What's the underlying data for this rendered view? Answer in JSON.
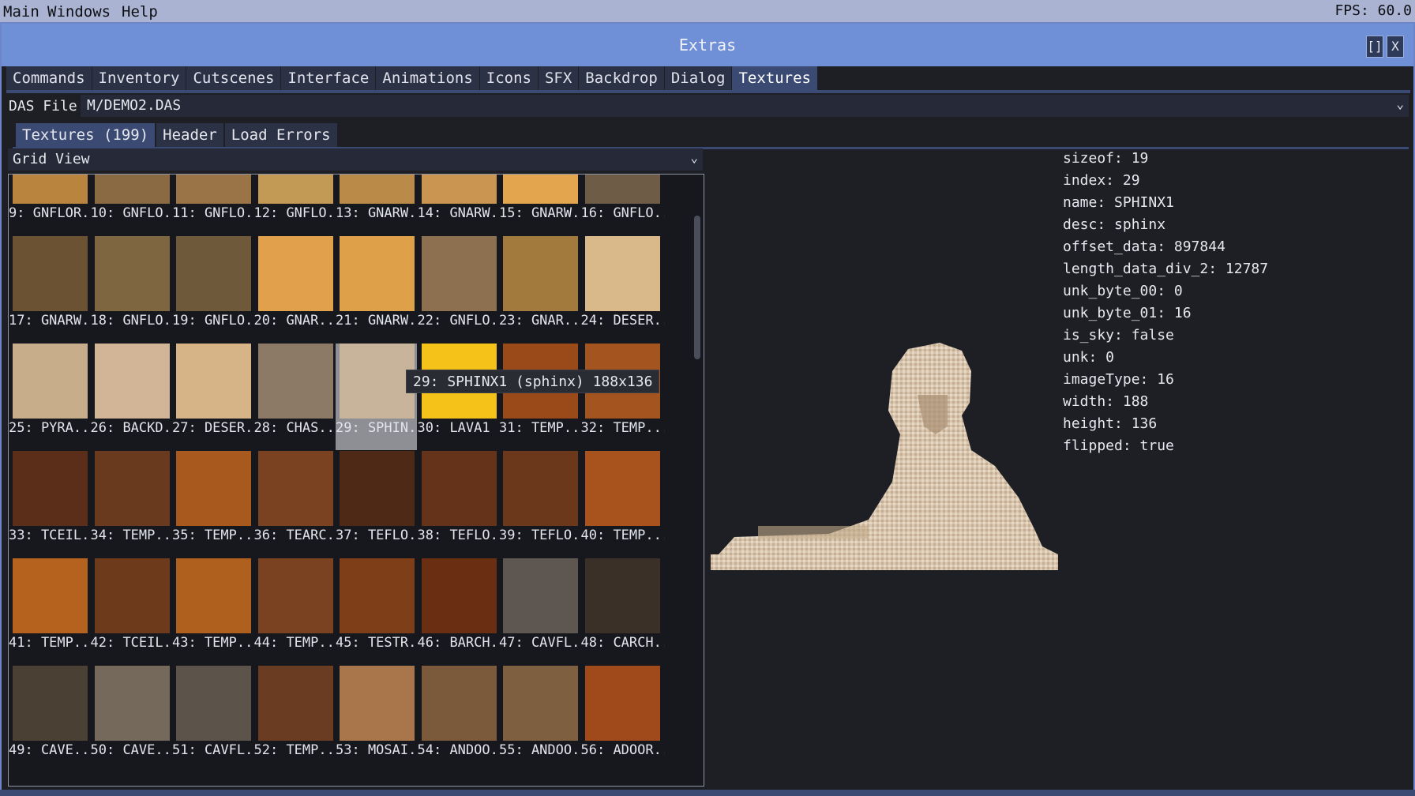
{
  "menubar": {
    "items": [
      "Main",
      "Windows",
      "Help"
    ],
    "fps": "FPS: 60.0"
  },
  "window": {
    "title": "Extras",
    "buttons": [
      "[]",
      "X"
    ]
  },
  "tabs": [
    "Commands",
    "Inventory",
    "Cutscenes",
    "Interface",
    "Animations",
    "Icons",
    "SFX",
    "Backdrop",
    "Dialog",
    "Textures"
  ],
  "active_tab": "Textures",
  "das_file": {
    "label": "DAS File:",
    "value": "M/DEMO2.DAS"
  },
  "subtabs": [
    "Textures (199)",
    "Header",
    "Load Errors"
  ],
  "active_subtab": "Textures (199)",
  "view_mode": "Grid View",
  "grid": {
    "selected_index": 29,
    "rows": [
      [
        {
          "label": "9: GNFLOR...",
          "color": "#b8843e"
        },
        {
          "label": "10: GNFLO...",
          "color": "#8a6a42"
        },
        {
          "label": "11: GNFLO...",
          "color": "#9a7446"
        },
        {
          "label": "12: GNFLO...",
          "color": "#c39a55"
        },
        {
          "label": "13: GNARW...",
          "color": "#b98a48"
        },
        {
          "label": "14: GNARW...",
          "color": "#c99550"
        },
        {
          "label": "15: GNARW...",
          "color": "#e3a54e"
        },
        {
          "label": "16: GNFLO...",
          "color": "#6f5c46"
        }
      ],
      [
        {
          "label": "17: GNARW...",
          "color": "#6a5233"
        },
        {
          "label": "18: GNFLO...",
          "color": "#7e6640"
        },
        {
          "label": "19: GNFLO...",
          "color": "#6e5a3a"
        },
        {
          "label": "20: GNAR...",
          "color": "#e0a04c"
        },
        {
          "label": "21: GNARW...",
          "color": "#dfa04a"
        },
        {
          "label": "22: GNFLO...",
          "color": "#8c7050"
        },
        {
          "label": "23: GNAR...",
          "color": "#a27a3e"
        },
        {
          "label": "24: DESER...",
          "color": "#d9b88a"
        }
      ],
      [
        {
          "label": "25: PYRA...",
          "color": "#c8ad8a"
        },
        {
          "label": "26: BACKD...",
          "color": "#d2b496"
        },
        {
          "label": "27: DESER...",
          "color": "#d6b488"
        },
        {
          "label": "28: CHAS...",
          "color": "#8c7a66"
        },
        {
          "label": "29: SPHIN...",
          "color": "#c7b49a"
        },
        {
          "label": "30: LAVA1 ...",
          "color": "#f5c21a"
        },
        {
          "label": "31: TEMP...",
          "color": "#9a4a18"
        },
        {
          "label": "32: TEMP...",
          "color": "#a4541e"
        }
      ],
      [
        {
          "label": "33: TCEIL...",
          "color": "#5a2e18"
        },
        {
          "label": "34: TEMP...",
          "color": "#6a3a1e"
        },
        {
          "label": "35: TEMP...",
          "color": "#a85a1e"
        },
        {
          "label": "36: TEARC...",
          "color": "#7a4220"
        },
        {
          "label": "37: TEFLO...",
          "color": "#4e2a16"
        },
        {
          "label": "38: TEFLO...",
          "color": "#64331a"
        },
        {
          "label": "39: TEFLO...",
          "color": "#6c381c"
        },
        {
          "label": "40: TEMP...",
          "color": "#a8521e"
        }
      ],
      [
        {
          "label": "41: TEMP...",
          "color": "#b4621e"
        },
        {
          "label": "42: TCEIL...",
          "color": "#6e3a1c"
        },
        {
          "label": "43: TEMP...",
          "color": "#b0601e"
        },
        {
          "label": "44: TEMP...",
          "color": "#7a4220"
        },
        {
          "label": "45: TESTR...",
          "color": "#7e3e18"
        },
        {
          "label": "46: BARCH...",
          "color": "#6a2e12"
        },
        {
          "label": "47: CAVFL...",
          "color": "#5e5650"
        },
        {
          "label": "48: CARCH...",
          "color": "#3a3028"
        }
      ],
      [
        {
          "label": "49: CAVE...",
          "color": "#4a4034"
        },
        {
          "label": "50: CAVE...",
          "color": "#75695c"
        },
        {
          "label": "51: CAVFL...",
          "color": "#5c544a"
        },
        {
          "label": "52: TEMP...",
          "color": "#6a3c22"
        },
        {
          "label": "53: MOSAI...",
          "color": "#a8764a"
        },
        {
          "label": "54: ANDOO...",
          "color": "#7a5a3a"
        },
        {
          "label": "55: ANDOO...",
          "color": "#7e6040"
        },
        {
          "label": "56: ADOOR...",
          "color": "#a04a1c"
        }
      ]
    ]
  },
  "tooltip": "29: SPHINX1 (sphinx) 188x136",
  "properties": [
    "sizeof: 19",
    "index: 29",
    "name: SPHINX1",
    "desc: sphinx",
    "offset_data: 897844",
    "length_data_div_2: 12787",
    "unk_byte_00: 0",
    "unk_byte_01: 16",
    "is_sky: false",
    "unk: 0",
    "imageType: 16",
    "width: 188",
    "height: 136",
    "flipped: true"
  ],
  "colors": {
    "titlebar": "#6f8fd6",
    "menubar": "#aab4d2",
    "tab_active": "#3a4a72",
    "tab_inactive": "#2c3246",
    "window_bg": "#1e1f25",
    "selected_cell": "#8e8f95"
  },
  "icons": {
    "dropdown": "chevron-down-icon",
    "maximize": "maximize-icon",
    "close": "close-icon"
  }
}
